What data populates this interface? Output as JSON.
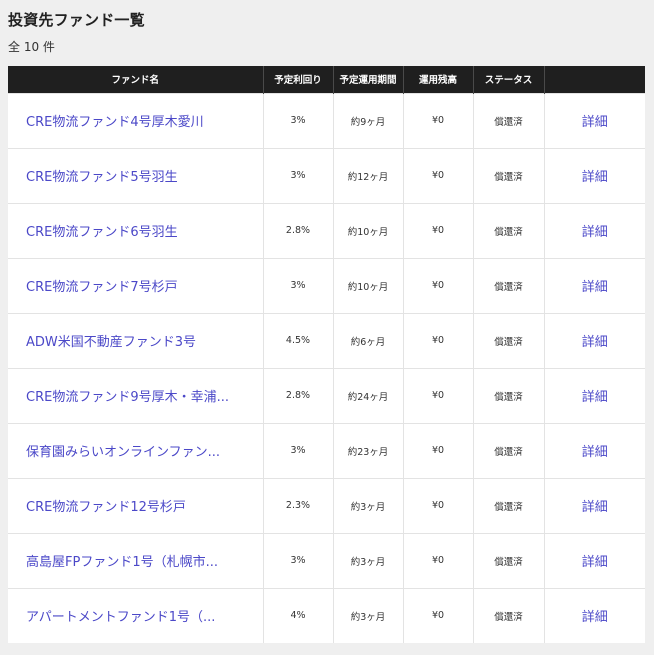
{
  "page": {
    "title": "投資先ファンド一覧",
    "count": "全 10 件"
  },
  "table": {
    "headers": [
      "ファンド名",
      "予定利回り",
      "予定運用期間",
      "運用残高",
      "ステータス",
      ""
    ],
    "rows": [
      {
        "name": "CRE物流ファンド4号厚木愛川",
        "yield": "3%",
        "period": "約9ヶ月",
        "balance": "¥0",
        "status": "償還済",
        "detail": "詳細"
      },
      {
        "name": "CRE物流ファンド5号羽生",
        "yield": "3%",
        "period": "約12ヶ月",
        "balance": "¥0",
        "status": "償還済",
        "detail": "詳細"
      },
      {
        "name": "CRE物流ファンド6号羽生",
        "yield": "2.8%",
        "period": "約10ヶ月",
        "balance": "¥0",
        "status": "償還済",
        "detail": "詳細"
      },
      {
        "name": "CRE物流ファンド7号杉戸",
        "yield": "3%",
        "period": "約10ヶ月",
        "balance": "¥0",
        "status": "償還済",
        "detail": "詳細"
      },
      {
        "name": "ADW米国不動産ファンド3号",
        "yield": "4.5%",
        "period": "約6ヶ月",
        "balance": "¥0",
        "status": "償還済",
        "detail": "詳細"
      },
      {
        "name": "CRE物流ファンド9号厚木・幸浦...",
        "yield": "2.8%",
        "period": "約24ヶ月",
        "balance": "¥0",
        "status": "償還済",
        "detail": "詳細"
      },
      {
        "name": "保育園みらいオンラインファン...",
        "yield": "3%",
        "period": "約23ヶ月",
        "balance": "¥0",
        "status": "償還済",
        "detail": "詳細"
      },
      {
        "name": "CRE物流ファンド12号杉戸",
        "yield": "2.3%",
        "period": "約3ヶ月",
        "balance": "¥0",
        "status": "償還済",
        "detail": "詳細"
      },
      {
        "name": "高島屋FPファンド1号（札幌市...",
        "yield": "3%",
        "period": "約3ヶ月",
        "balance": "¥0",
        "status": "償還済",
        "detail": "詳細"
      },
      {
        "name": "アパートメントファンド1号（...",
        "yield": "4%",
        "period": "約3ヶ月",
        "balance": "¥0",
        "status": "償還済",
        "detail": "詳細"
      }
    ]
  },
  "colors": {
    "header_bg": "#1f1f1f",
    "link": "#4b48c8",
    "page_bg": "#efefef"
  }
}
